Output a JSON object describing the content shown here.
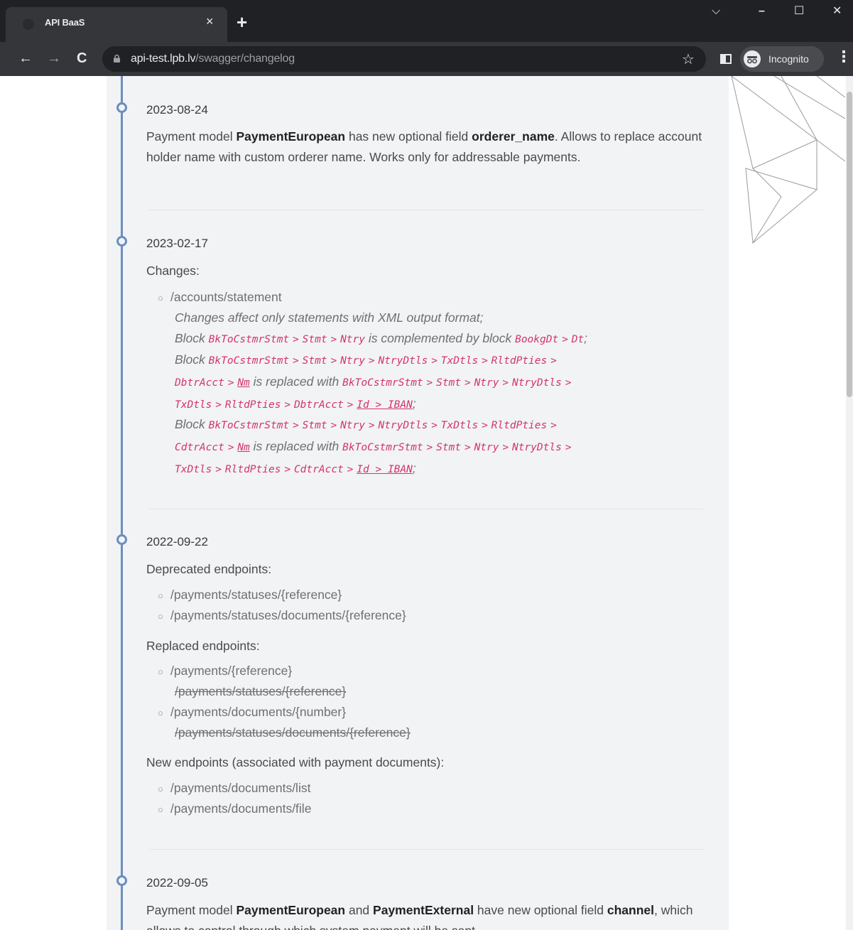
{
  "browser": {
    "tab_title": "API BaaS",
    "tab_close": "×",
    "new_tab": "+",
    "window_controls": {
      "chevron": "⌵",
      "minimize": "–",
      "maximize": "☐",
      "close": "✕"
    },
    "nav": {
      "back": "←",
      "forward": "→",
      "reload": "C"
    },
    "url_host": "api-test.lpb.lv",
    "url_path": "/swagger/changelog",
    "star": "☆",
    "incognito_label": "Incognito",
    "menu": "⋮",
    "icons": [
      "favicon",
      "lock-icon",
      "star-icon",
      "side-panel-icon",
      "incognito-icon",
      "menu-icon"
    ]
  },
  "colors": {
    "timeline": "#6c8ebf",
    "content_bg": "#f1f3f5",
    "code": "#d6336c"
  },
  "changelog": {
    "e1": {
      "date": "2023-08-24",
      "t1": "Payment model ",
      "b1": "PaymentEuropean",
      "t2": " has new optional field ",
      "b2": "orderer_name",
      "t3": ". Allows to replace account holder name with custom orderer name. Works only for addressable payments."
    },
    "e2": {
      "date": "2023-02-17",
      "heading": "Changes:",
      "endpoint": "/accounts/statement",
      "note": "Changes affect only statements with XML output format;",
      "block": "Block",
      "complemented": "is complemented by block",
      "replaced": "is replaced with",
      "semi": ";",
      "sep": ">",
      "path_a": [
        "BkToCstmrStmt",
        "Stmt",
        "Ntry"
      ],
      "path_b": [
        "BookgDt",
        "Dt"
      ],
      "p2_l1": [
        "BkToCstmrStmt",
        "Stmt",
        "Ntry",
        "NtryDtls",
        "TxDtls",
        "RltdPties"
      ],
      "p2_l2a": [
        "DbtrAcct",
        "Nm"
      ],
      "p2_l2b": [
        "BkToCstmrStmt",
        "Stmt",
        "Ntry",
        "NtryDtls"
      ],
      "p2_l3": [
        "TxDtls",
        "RltdPties",
        "DbtrAcct",
        "Id",
        "IBAN"
      ],
      "p3_l1": [
        "BkToCstmrStmt",
        "Stmt",
        "Ntry",
        "NtryDtls",
        "TxDtls",
        "RltdPties"
      ],
      "p3_l2a": [
        "CdtrAcct",
        "Nm"
      ],
      "p3_l2b": [
        "BkToCstmrStmt",
        "Stmt",
        "Ntry",
        "NtryDtls"
      ],
      "p3_l3": [
        "TxDtls",
        "RltdPties",
        "CdtrAcct",
        "Id",
        "IBAN"
      ]
    },
    "e3": {
      "date": "2022-09-22",
      "deprecated_heading": "Deprecated endpoints:",
      "deprecated": [
        "/payments/statuses/{reference}",
        "/payments/statuses/documents/{reference}"
      ],
      "replaced_heading": "Replaced endpoints:",
      "replaced": [
        {
          "new": "/payments/{reference}",
          "old": "/payments/statuses/{reference}"
        },
        {
          "new": "/payments/documents/{number}",
          "old": "/payments/statuses/documents/{reference}"
        }
      ],
      "new_heading": "New endpoints (associated with payment documents):",
      "new": [
        "/payments/documents/list",
        "/payments/documents/file"
      ]
    },
    "e4": {
      "date": "2022-09-05",
      "t1": "Payment model ",
      "b1": "PaymentEuropean",
      "t2": " and ",
      "b2": "PaymentExternal",
      "t3": " have new optional field ",
      "b3": "channel",
      "t4": ", which allows to control through which system payment will be sent."
    }
  }
}
